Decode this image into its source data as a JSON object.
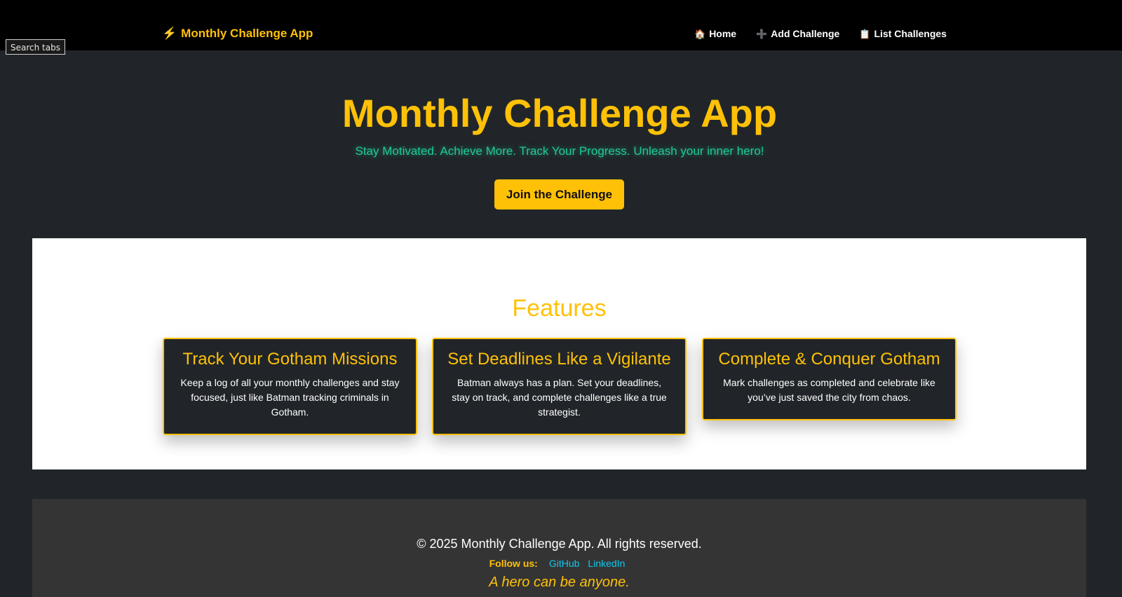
{
  "navbar": {
    "brand_icon": "⚡",
    "brand_label": "Monthly Challenge App",
    "links": [
      {
        "icon": "🏠",
        "label": "Home"
      },
      {
        "icon": "➕",
        "label": "Add Challenge"
      },
      {
        "icon": "📋",
        "label": "List Challenges"
      }
    ]
  },
  "browser": {
    "search_tabs_label": "Search tabs"
  },
  "hero": {
    "title": "Monthly Challenge App",
    "subtitle": "Stay Motivated. Achieve More. Track Your Progress. Unleash your inner hero!",
    "cta_label": "Join the Challenge"
  },
  "features": {
    "title": "Features",
    "cards": [
      {
        "title": "Track Your Gotham Missions",
        "text": "Keep a log of all your monthly challenges and stay focused, just like Batman tracking criminals in Gotham."
      },
      {
        "title": "Set Deadlines Like a Vigilante",
        "text": "Batman always has a plan. Set your deadlines, stay on track, and complete challenges like a true strategist."
      },
      {
        "title": "Complete & Conquer Gotham",
        "text": "Mark challenges as completed and celebrate like you’ve just saved the city from chaos."
      }
    ]
  },
  "footer": {
    "copyright": "© 2025 Monthly Challenge App. All rights reserved.",
    "follow_label": "Follow us:",
    "links": [
      "GitHub",
      "LinkedIn"
    ],
    "tagline": "A hero can be anyone."
  },
  "colors": {
    "accent": "#ffc107",
    "teal": "#20c997",
    "link": "#0dcaf0",
    "dark": "#212529",
    "navbar": "#000000",
    "footer": "#343434"
  }
}
